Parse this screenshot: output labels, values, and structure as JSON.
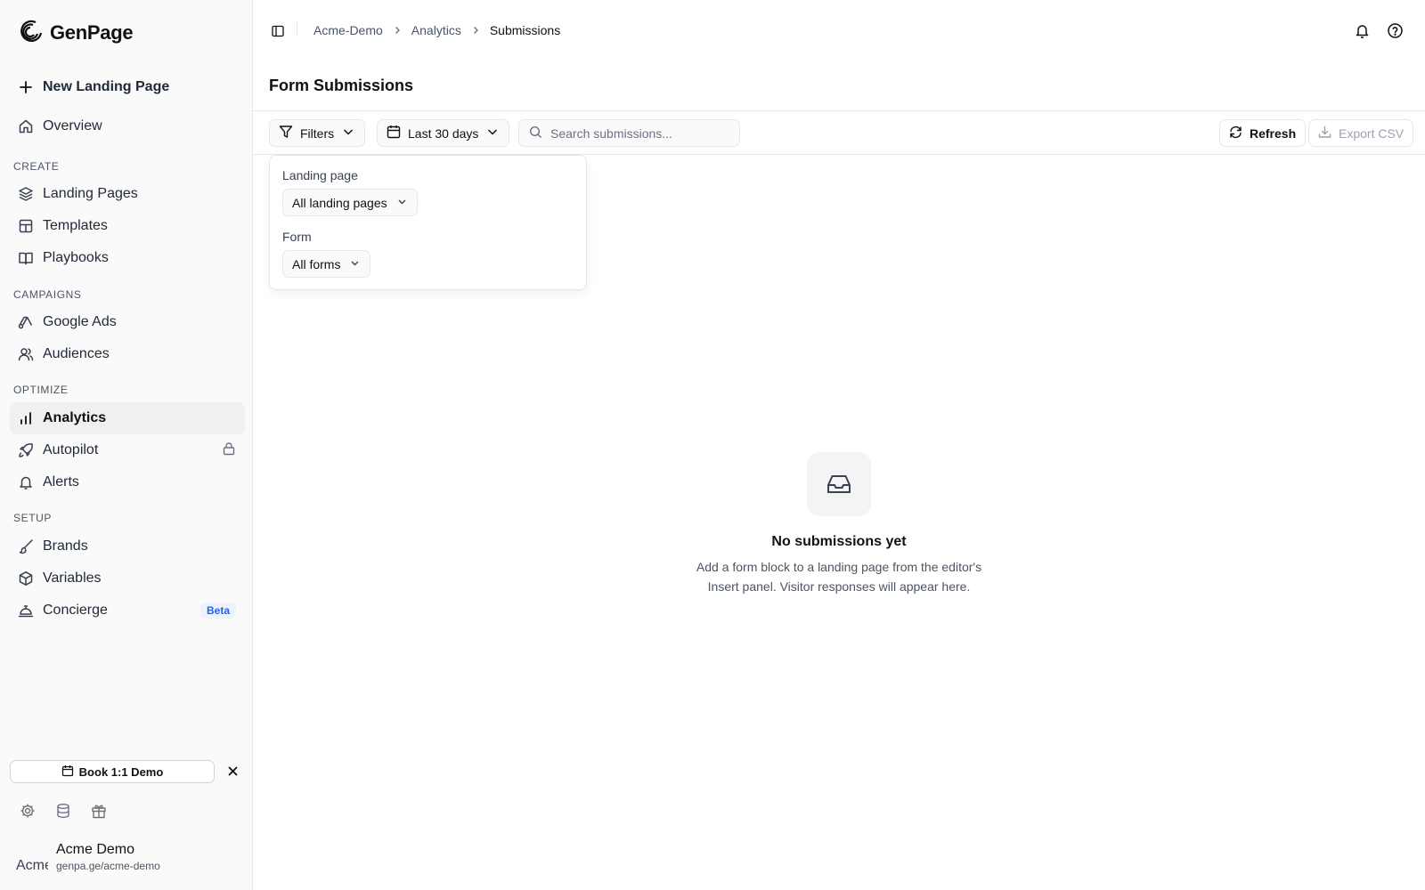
{
  "app": {
    "name": "GenPage"
  },
  "sidebar": {
    "new_page_label": "New Landing Page",
    "overview_label": "Overview",
    "sections": {
      "create": "CREATE",
      "campaigns": "CAMPAIGNS",
      "optimize": "OPTIMIZE",
      "setup": "SETUP"
    },
    "items": {
      "landing_pages": "Landing Pages",
      "templates": "Templates",
      "playbooks": "Playbooks",
      "google_ads": "Google Ads",
      "audiences": "Audiences",
      "analytics": "Analytics",
      "autopilot": "Autopilot",
      "alerts": "Alerts",
      "brands": "Brands",
      "variables": "Variables",
      "concierge": "Concierge"
    },
    "concierge_badge": "Beta",
    "demo_button": "Book 1:1 Demo",
    "account": {
      "name": "Acme Demo",
      "url": "genpa.ge/acme-demo",
      "avatar_alt": "Acme"
    }
  },
  "breadcrumb": {
    "items": [
      "Acme-Demo",
      "Analytics",
      "Submissions"
    ]
  },
  "page": {
    "title": "Form Submissions"
  },
  "toolbar": {
    "filters_label": "Filters",
    "date_range_label": "Last 30 days",
    "search_placeholder": "Search submissions...",
    "refresh_label": "Refresh",
    "export_label": "Export CSV"
  },
  "filter_popover": {
    "landing_page_label": "Landing page",
    "landing_page_value": "All landing pages",
    "form_label": "Form",
    "form_value": "All forms"
  },
  "empty_state": {
    "title": "No submissions yet",
    "description": "Add a form block to a landing page from the editor's Insert panel. Visitor responses will appear here."
  }
}
